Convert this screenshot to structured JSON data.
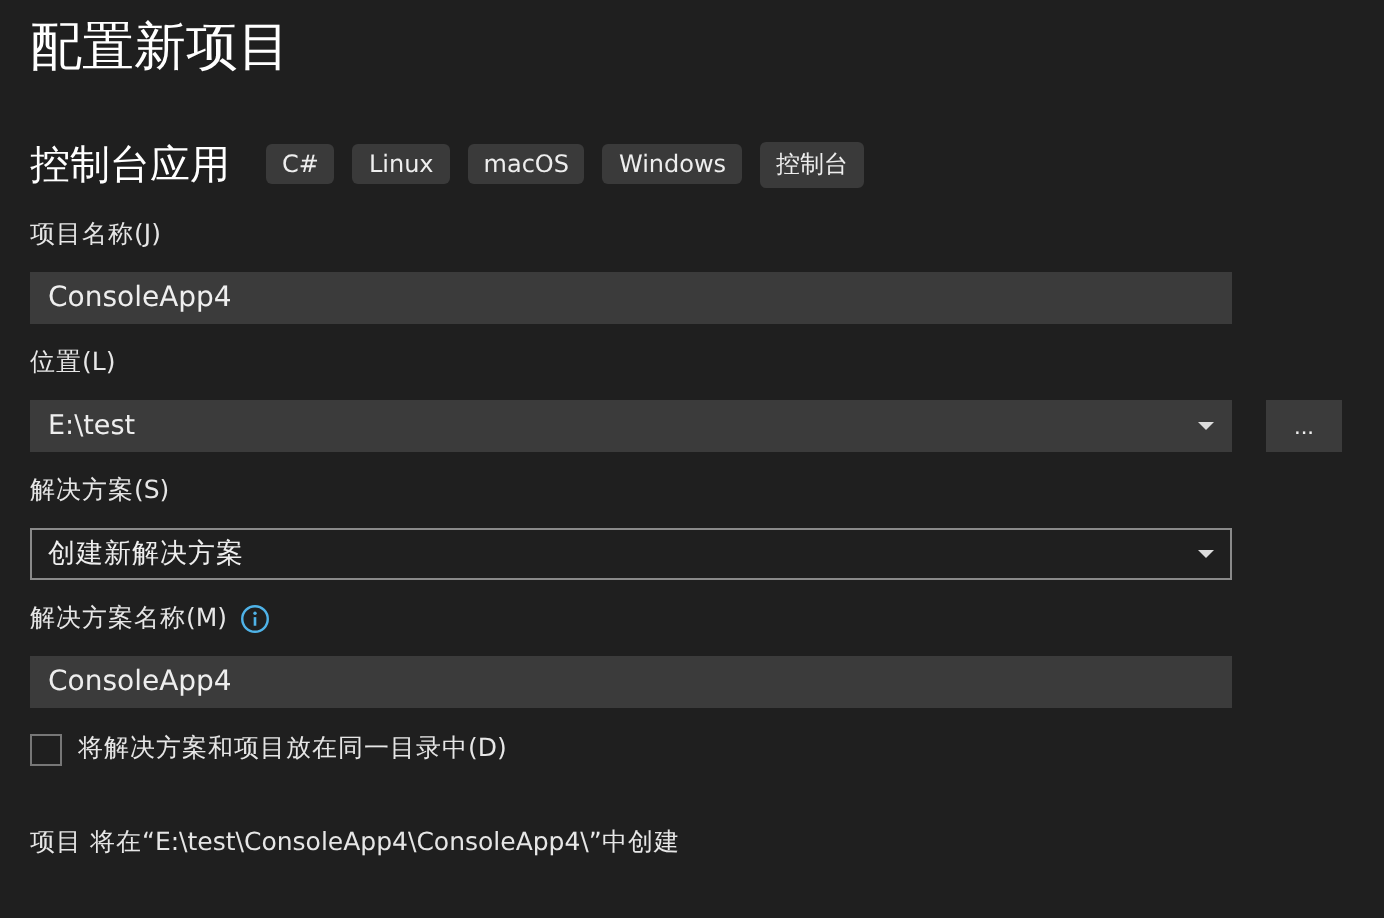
{
  "title": "配置新项目",
  "template": {
    "name": "控制台应用",
    "tags": [
      "C#",
      "Linux",
      "macOS",
      "Windows",
      "控制台"
    ]
  },
  "fields": [
    {
      "kind": "input",
      "label": "项目名称(J)",
      "value": "ConsoleApp4",
      "info": false
    },
    {
      "kind": "combo",
      "label": "位置(L)",
      "value": "E:\\test",
      "browse": "..."
    },
    {
      "kind": "dropdown",
      "label": "解决方案(S)",
      "value": "创建新解决方案"
    },
    {
      "kind": "input",
      "label": "解决方案名称(M)",
      "value": "ConsoleApp4",
      "info": true
    }
  ],
  "checkbox": {
    "label": "将解决方案和项目放在同一目录中(D)",
    "checked": false
  },
  "footer": "项目 将在“E:\\test\\ConsoleApp4\\ConsoleApp4\\”中创建"
}
